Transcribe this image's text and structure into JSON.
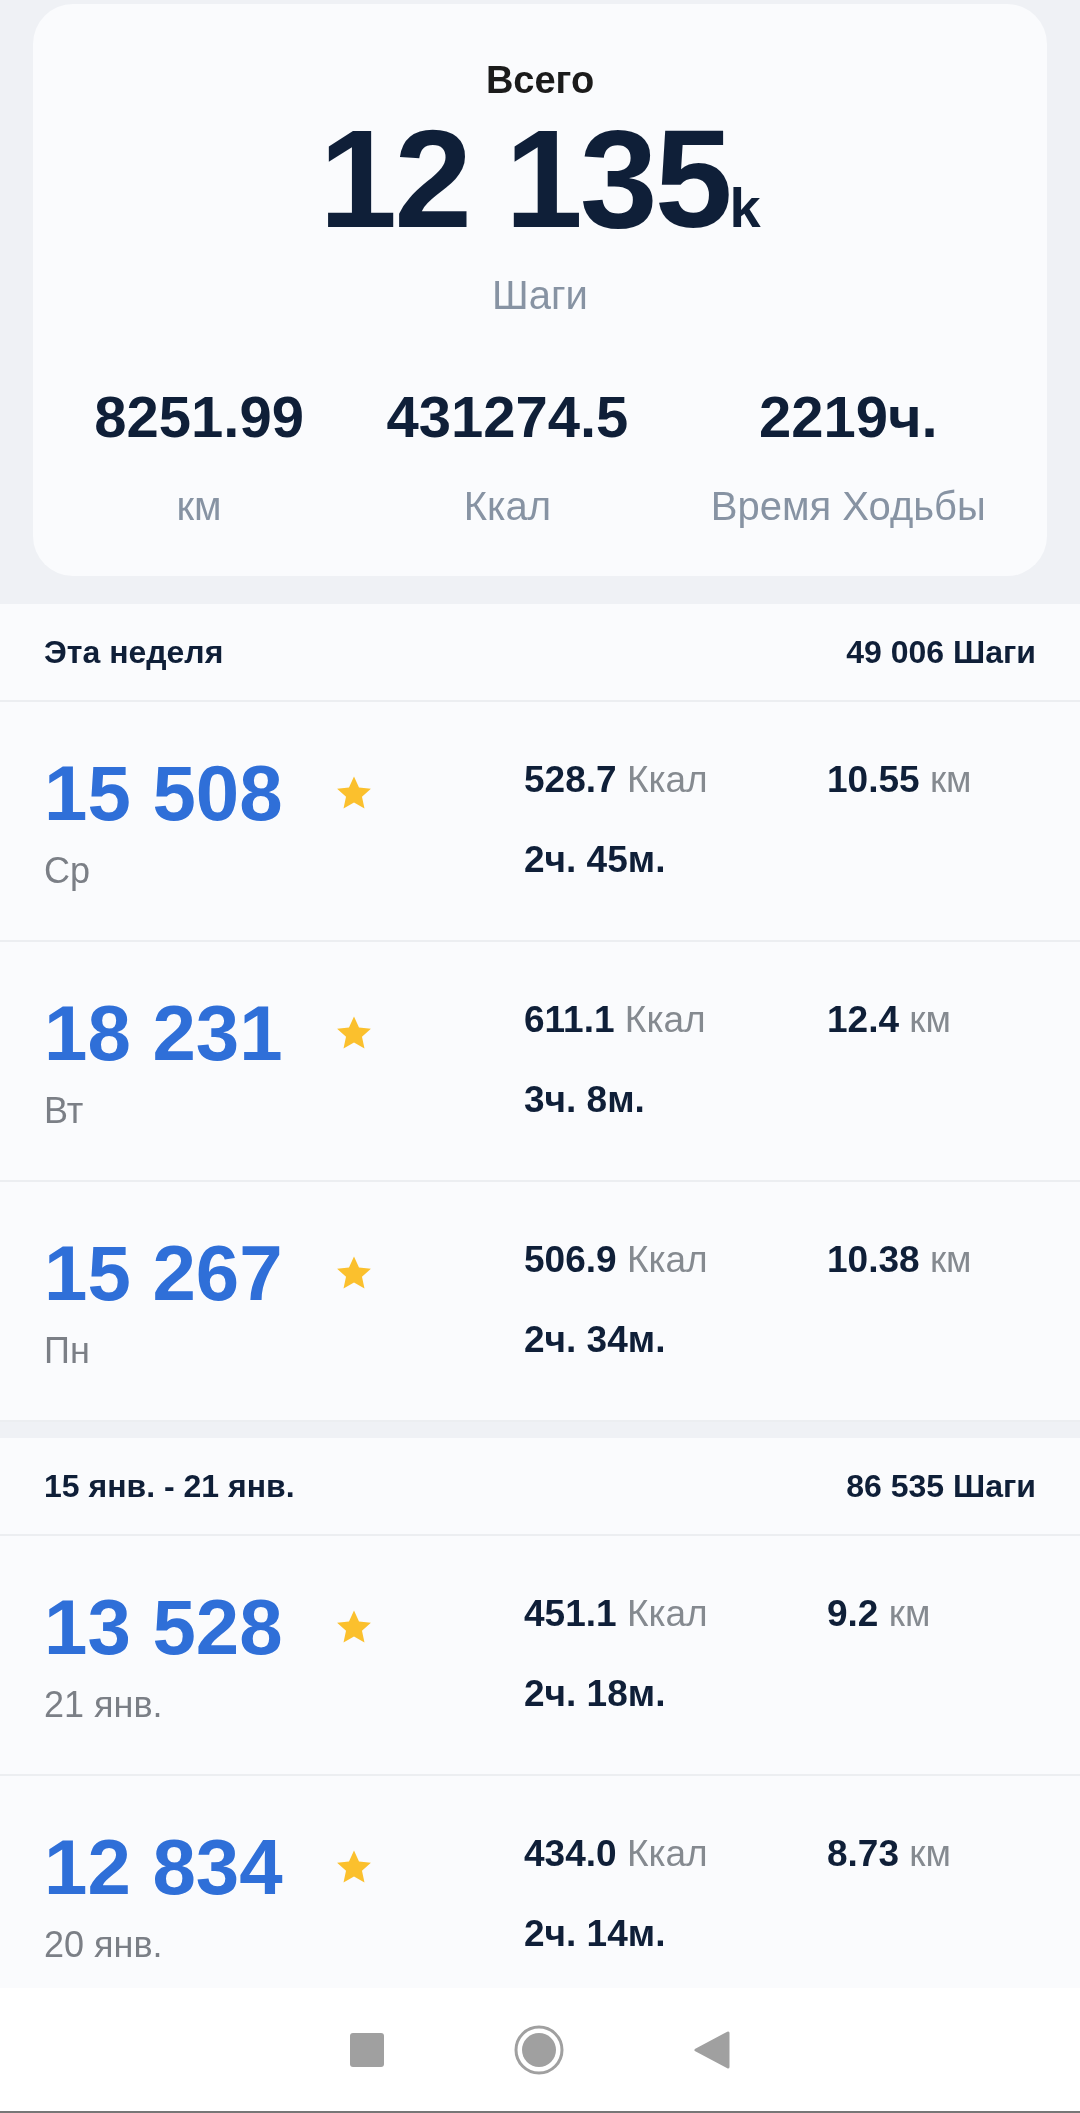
{
  "total": {
    "title": "Всего",
    "steps": "12 135",
    "steps_suffix": "k",
    "steps_label": "Шаги",
    "stats": [
      {
        "value": "8251.99",
        "label": "км"
      },
      {
        "value": "431274.5",
        "label": "Ккал"
      },
      {
        "value": "2219ч.",
        "label": "Время Ходьбы"
      }
    ]
  },
  "weeks": [
    {
      "title": "Эта неделя",
      "total": "49 006 Шаги",
      "days": [
        {
          "steps": "15 508",
          "goal_reached": true,
          "day": "Ср",
          "kcal": "528.7",
          "kcal_unit": "Ккал",
          "km": "10.55",
          "km_unit": "км",
          "time": "2ч. 45м."
        },
        {
          "steps": "18 231",
          "goal_reached": true,
          "day": "Вт",
          "kcal": "611.1",
          "kcal_unit": "Ккал",
          "km": "12.4",
          "km_unit": "км",
          "time": "3ч. 8м."
        },
        {
          "steps": "15 267",
          "goal_reached": true,
          "day": "Пн",
          "kcal": "506.9",
          "kcal_unit": "Ккал",
          "km": "10.38",
          "km_unit": "км",
          "time": "2ч. 34м."
        }
      ]
    },
    {
      "title": "15 янв. - 21 янв.",
      "total": "86 535 Шаги",
      "days": [
        {
          "steps": "13 528",
          "goal_reached": true,
          "day": "21 янв.",
          "kcal": "451.1",
          "kcal_unit": "Ккал",
          "km": "9.2",
          "km_unit": "км",
          "time": "2ч. 18м."
        },
        {
          "steps": "12 834",
          "goal_reached": true,
          "day": "20 янв.",
          "kcal": "434.0",
          "kcal_unit": "Ккал",
          "km": "8.73",
          "km_unit": "км",
          "time": "2ч. 14м."
        }
      ]
    }
  ]
}
